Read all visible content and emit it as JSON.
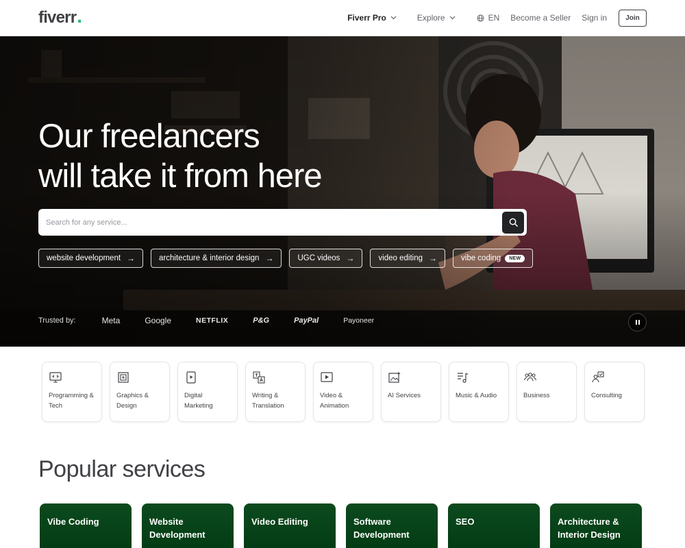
{
  "header": {
    "logo": "fiverr",
    "logo_dot": ".",
    "nav": {
      "pro": "Fiverr Pro",
      "explore": "Explore",
      "lang": "EN",
      "seller": "Become a Seller",
      "signin": "Sign in",
      "join": "Join"
    }
  },
  "hero": {
    "title_line1": "Our freelancers",
    "title_line2": "will take it from here",
    "search_placeholder": "Search for any service...",
    "chips": [
      {
        "label": "website development",
        "arrow": "→"
      },
      {
        "label": "architecture & interior design",
        "arrow": "→"
      },
      {
        "label": "UGC videos",
        "arrow": "→"
      },
      {
        "label": "video editing",
        "arrow": "→"
      },
      {
        "label": "vibe coding",
        "badge": "NEW"
      }
    ],
    "trusted_label": "Trusted by:",
    "brands": [
      "Meta",
      "Google",
      "NETFLIX",
      "P&G",
      "PayPal",
      "Payoneer"
    ]
  },
  "categories": [
    {
      "label": "Programming & Tech",
      "icon": "monitor-code-icon"
    },
    {
      "label": "Graphics & Design",
      "icon": "design-frame-icon"
    },
    {
      "label": "Digital Marketing",
      "icon": "phone-play-icon"
    },
    {
      "label": "Writing & Translation",
      "icon": "translate-icon"
    },
    {
      "label": "Video & Animation",
      "icon": "video-play-icon"
    },
    {
      "label": "AI Services",
      "icon": "ai-sparkle-icon"
    },
    {
      "label": "Music & Audio",
      "icon": "music-icon"
    },
    {
      "label": "Business",
      "icon": "people-icon"
    },
    {
      "label": "Consulting",
      "icon": "consulting-icon"
    }
  ],
  "popular": {
    "title": "Popular services",
    "services": [
      "Vibe Coding",
      "Website Development",
      "Video Editing",
      "Software Development",
      "SEO",
      "Architecture & Interior Design"
    ]
  },
  "colors": {
    "brand_green": "#1dbf73",
    "service_card": "#00461a",
    "text_dark": "#404145"
  }
}
